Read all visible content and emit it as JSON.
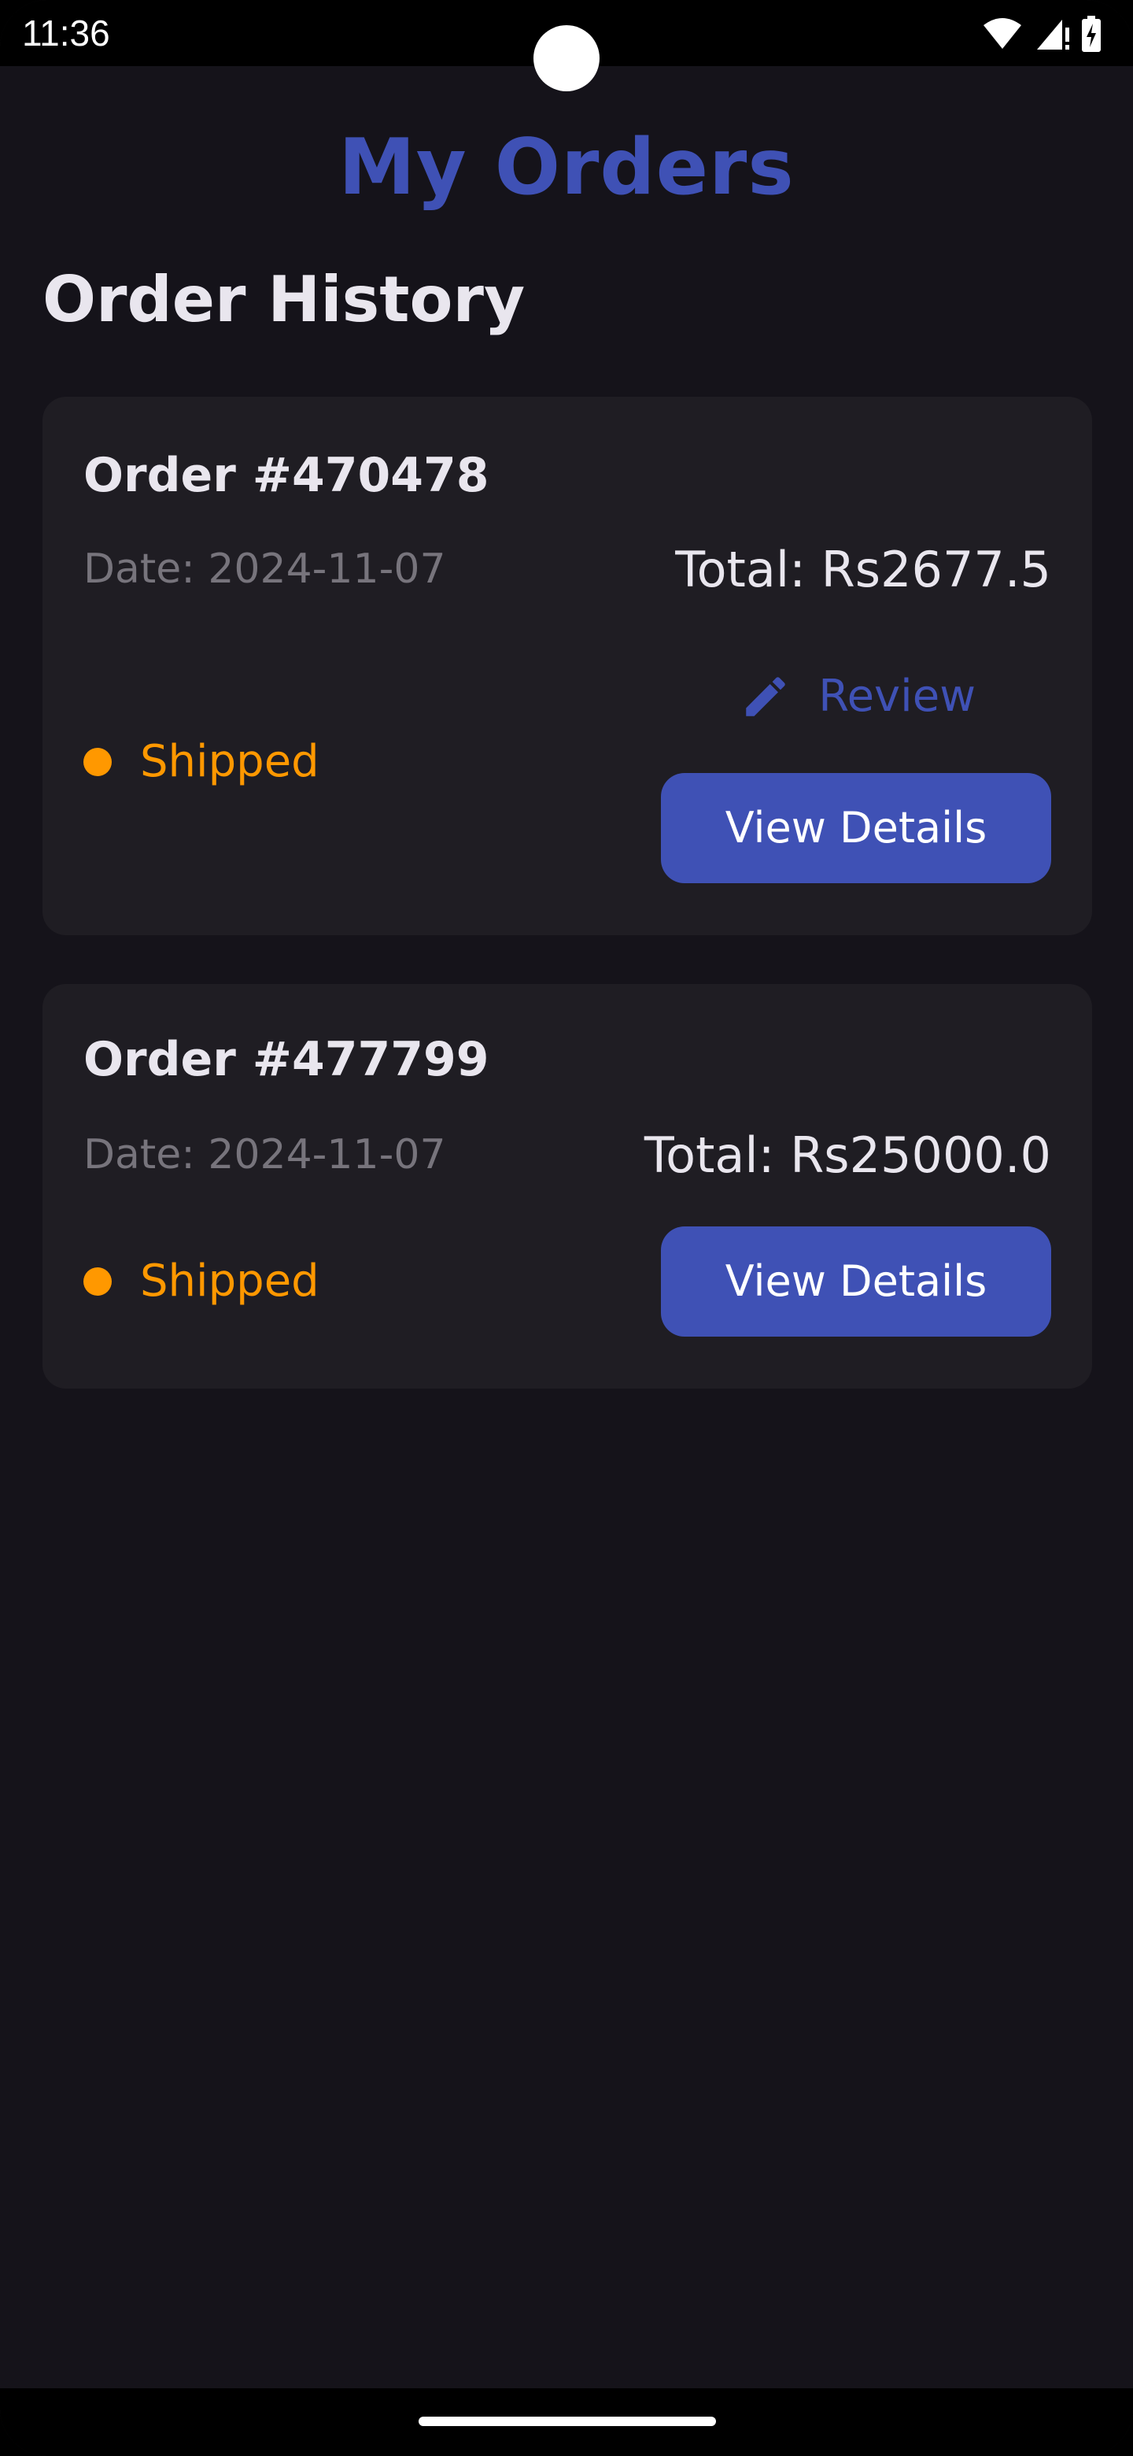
{
  "status_bar": {
    "time": "11:36",
    "icons": [
      "wifi-icon",
      "signal-icon",
      "battery-charging-icon"
    ]
  },
  "header": {
    "title": "My Orders",
    "section_title": "Order History"
  },
  "orders": [
    {
      "number": "Order #470478",
      "date": "Date: 2024-11-07",
      "total": "Total: Rs2677.5",
      "status": "Shipped",
      "review_label": "Review",
      "details_label": "View Details"
    },
    {
      "number": "Order #477799",
      "date": "Date: 2024-11-07",
      "total": "Total: Rs25000.0",
      "status": "Shipped",
      "details_label": "View Details"
    }
  ],
  "colors": {
    "background": "#15131a",
    "card": "#1f1d23",
    "accent": "#3f51b5",
    "status_shipped": "#ff9800",
    "text_primary": "#e9e6ee",
    "text_secondary": "#77747c"
  }
}
